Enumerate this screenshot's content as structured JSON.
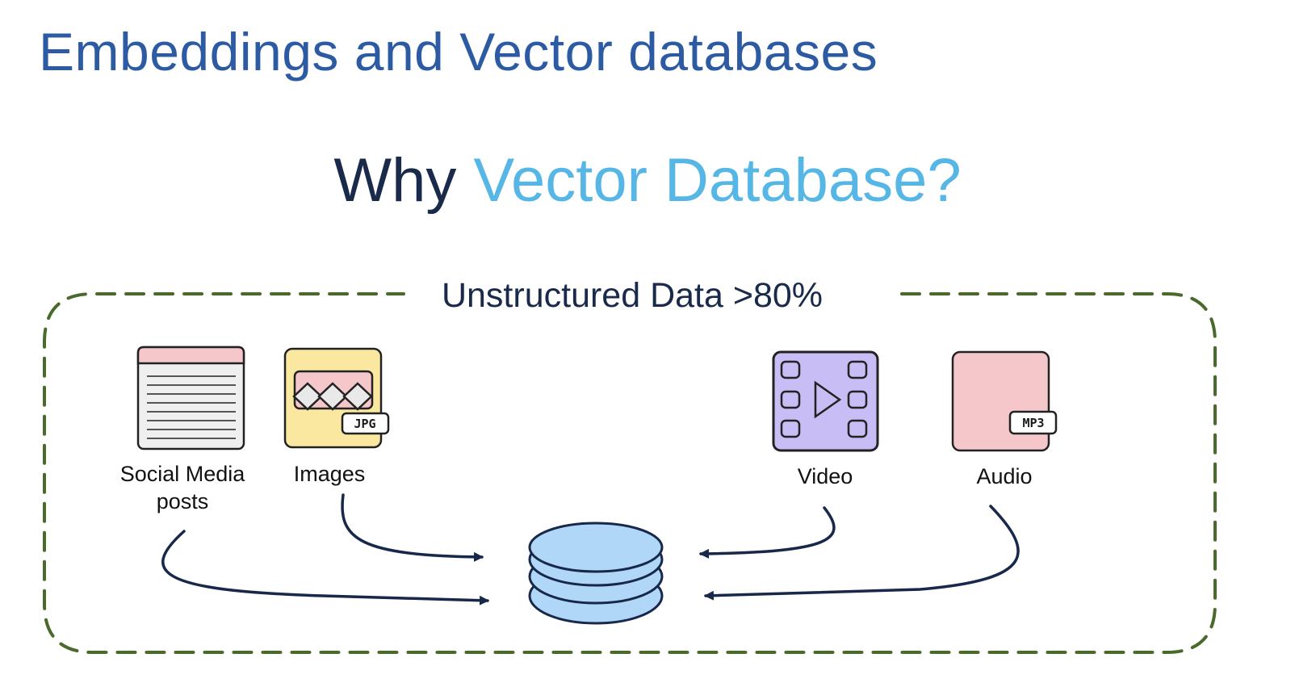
{
  "page": {
    "title": "Embeddings and Vector databases",
    "subtitle_prefix": "Why",
    "subtitle_accent": "Vector Database?"
  },
  "diagram": {
    "group_label": "Unstructured Data >80%",
    "sources": [
      {
        "id": "social",
        "label_lines": [
          "Social Media",
          "posts"
        ],
        "icon": "document-icon"
      },
      {
        "id": "images",
        "label_lines": [
          "Images"
        ],
        "icon": "image-file-icon",
        "badge": "JPG"
      },
      {
        "id": "video",
        "label_lines": [
          "Video"
        ],
        "icon": "film-strip-icon"
      },
      {
        "id": "audio",
        "label_lines": [
          "Audio"
        ],
        "icon": "audio-file-icon",
        "badge": "MP3"
      }
    ],
    "target": {
      "icon": "database-icon"
    }
  },
  "colors": {
    "title": "#2d5ba3",
    "subtitle": "#1a2a4a",
    "accent": "#56b7e6",
    "dashed_border": "#4a6a2c",
    "arrow": "#17284a",
    "document_header": "#f5c7ca",
    "document_body": "#efefef",
    "image_fill": "#fbe8a0",
    "image_banner": "#f5c7ca",
    "video_fill": "#c9bdf5",
    "audio_fill": "#f5c7ca",
    "database_fill": "#b0d7f7"
  }
}
